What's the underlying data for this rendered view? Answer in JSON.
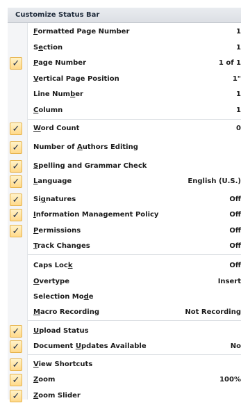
{
  "menu": {
    "title": "Customize Status Bar",
    "items": [
      {
        "label_pre": "",
        "label_mnemonic": "F",
        "label_post": "ormatted Page Number",
        "value": "1",
        "checked": false
      },
      {
        "label_pre": "S",
        "label_mnemonic": "e",
        "label_post": "ction",
        "value": "1",
        "checked": false
      },
      {
        "label_pre": "",
        "label_mnemonic": "P",
        "label_post": "age Number",
        "value": "1 of 1",
        "checked": true
      },
      {
        "label_pre": "",
        "label_mnemonic": "V",
        "label_post": "ertical Page Position",
        "value": "1\"",
        "checked": false
      },
      {
        "label_pre": "Line Num",
        "label_mnemonic": "b",
        "label_post": "er",
        "value": "1",
        "checked": false
      },
      {
        "label_pre": "",
        "label_mnemonic": "C",
        "label_post": "olumn",
        "value": "1",
        "checked": false
      },
      {
        "label_pre": "",
        "label_mnemonic": "W",
        "label_post": "ord Count",
        "value": "0",
        "checked": true
      },
      {
        "label_pre": "Number of ",
        "label_mnemonic": "A",
        "label_post": "uthors Editing",
        "value": "",
        "checked": true
      },
      {
        "label_pre": "",
        "label_mnemonic": "S",
        "label_post": "pelling and Grammar Check",
        "value": "",
        "checked": true
      },
      {
        "label_pre": "",
        "label_mnemonic": "L",
        "label_post": "anguage",
        "value": "English (U.S.)",
        "checked": true
      },
      {
        "label_pre": "Si",
        "label_mnemonic": "g",
        "label_post": "natures",
        "value": "Off",
        "checked": true
      },
      {
        "label_pre": "",
        "label_mnemonic": "I",
        "label_post": "nformation Management Policy",
        "value": "Off",
        "checked": true
      },
      {
        "label_pre": "",
        "label_mnemonic": "P",
        "label_post": "ermissions",
        "value": "Off",
        "checked": true
      },
      {
        "label_pre": "",
        "label_mnemonic": "T",
        "label_post": "rack Changes",
        "value": "Off",
        "checked": false
      },
      {
        "label_pre": "Caps Loc",
        "label_mnemonic": "k",
        "label_post": "",
        "value": "Off",
        "checked": false
      },
      {
        "label_pre": "",
        "label_mnemonic": "O",
        "label_post": "vertype",
        "value": "Insert",
        "checked": false
      },
      {
        "label_pre": "Selection Mo",
        "label_mnemonic": "d",
        "label_post": "e",
        "value": "",
        "checked": false
      },
      {
        "label_pre": "",
        "label_mnemonic": "M",
        "label_post": "acro Recording",
        "value": "Not Recording",
        "checked": false
      },
      {
        "label_pre": "",
        "label_mnemonic": "U",
        "label_post": "pload Status",
        "value": "",
        "checked": true
      },
      {
        "label_pre": "Document ",
        "label_mnemonic": "U",
        "label_post": "pdates Available",
        "value": "No",
        "checked": true
      },
      {
        "label_pre": "",
        "label_mnemonic": "V",
        "label_post": "iew Shortcuts",
        "value": "",
        "checked": true
      },
      {
        "label_pre": "",
        "label_mnemonic": "Z",
        "label_post": "oom",
        "value": "100%",
        "checked": true
      },
      {
        "label_pre": "",
        "label_mnemonic": "Z",
        "label_post": "oom Slider",
        "value": "",
        "checked": true
      }
    ]
  },
  "icons": {
    "check": "checkmark-icon"
  },
  "colors": {
    "check_border": "#e6b24a",
    "check_fill": "#ffd98a",
    "title_bg": "#dcdfe4"
  }
}
